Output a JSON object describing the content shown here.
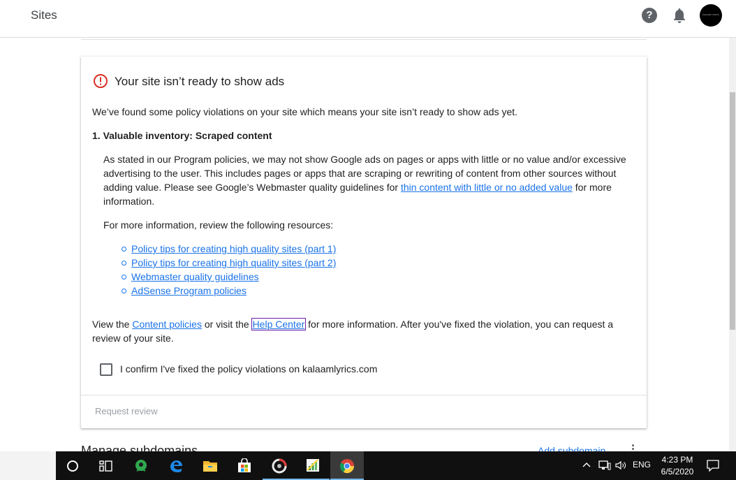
{
  "topbar": {
    "title": "Sites",
    "help_icon": "help-circle-icon",
    "bell_icon": "notification-bell-icon",
    "avatar_text": "KALAAM LYRICS"
  },
  "card": {
    "heading": "Your site isn’t ready to show ads",
    "intro": "We’ve found some policy violations on your site which means your site isn’t ready to show ads yet.",
    "section_title": "1. Valuable inventory: Scraped content",
    "body_before_link": "As stated in our Program policies, we may not show Google ads on pages or apps with little or no value and/or excessive advertising to the user. This includes pages or apps that are scraping or rewriting of content from other sources without adding value. Please see Google’s Webmaster quality guidelines for ",
    "body_link": "thin content with little or no added value",
    "body_after_link": " for more information.",
    "resources_intro": "For more information, review the following resources:",
    "resource_links": [
      "Policy tips for creating high quality sites (part 1)",
      "Policy tips for creating high quality sites (part 2)",
      "Webmaster quality guidelines",
      "AdSense Program policies"
    ],
    "view_prefix": "View the ",
    "content_policies": "Content policies",
    "view_middle": " or visit the ",
    "help_center": "Help Center",
    "view_suffix": " for more information. After you've fixed the violation, you can request a review of your site.",
    "confirm_label": "I confirm I've fixed the policy violations on kalaamlyrics.com",
    "request_review": "Request review"
  },
  "below": {
    "manage_title": "Manage subdomains",
    "add_subdomain": "Add subdomain"
  },
  "taskbar": {
    "language": "ENG",
    "time": "4:23 PM",
    "date": "6/5/2020",
    "apps": [
      "cortana-icon",
      "task-view-icon",
      "green-app-icon",
      "edge-icon",
      "file-explorer-icon",
      "store-icon",
      "dark-app-icon",
      "spreadsheet-icon",
      "chrome-icon"
    ]
  }
}
